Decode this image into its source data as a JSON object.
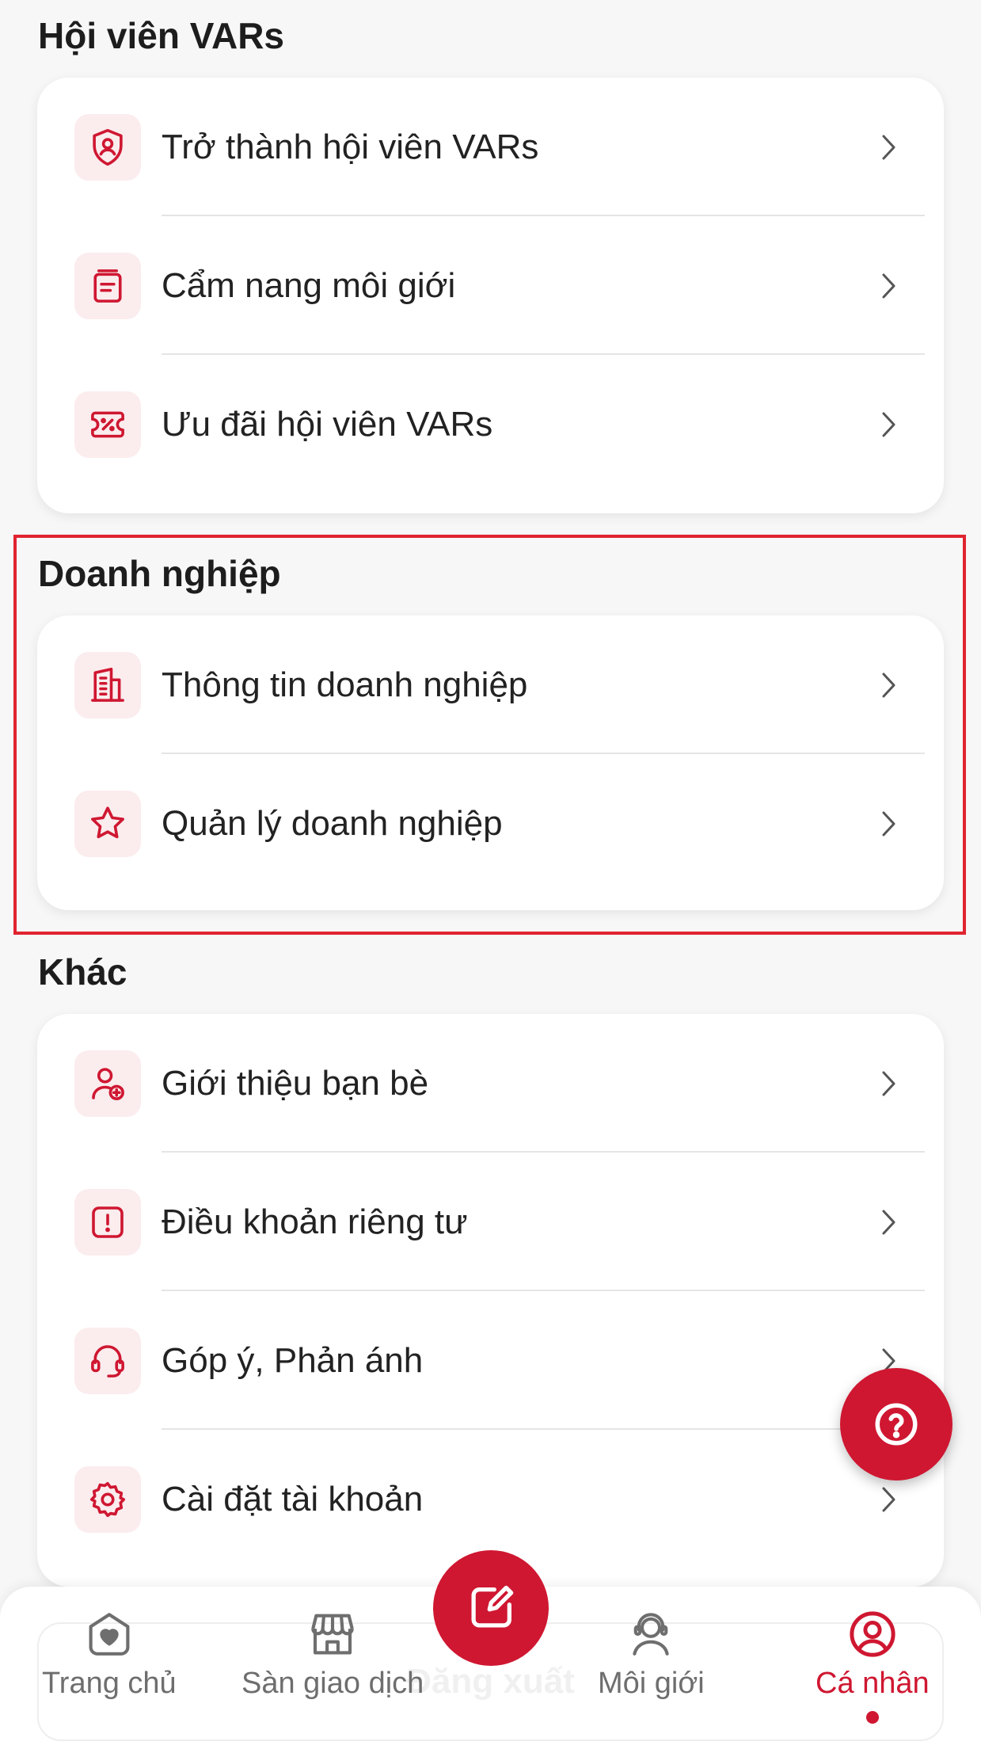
{
  "sections": {
    "members": {
      "title": "Hội viên VARs",
      "items": [
        {
          "label": "Trở thành hội viên VARs",
          "icon": "shield-user-icon"
        },
        {
          "label": "Cẩm nang môi giới",
          "icon": "handbook-icon"
        },
        {
          "label": "Ưu đãi hội viên VARs",
          "icon": "discount-ticket-icon"
        }
      ]
    },
    "business": {
      "title": "Doanh nghiệp",
      "items": [
        {
          "label": "Thông tin doanh nghiệp",
          "icon": "building-icon"
        },
        {
          "label": "Quản lý doanh nghiệp",
          "icon": "star-icon"
        }
      ]
    },
    "other": {
      "title": "Khác",
      "items": [
        {
          "label": "Giới thiệu bạn bè",
          "icon": "user-add-icon"
        },
        {
          "label": "Điều khoản riêng tư",
          "icon": "alert-icon"
        },
        {
          "label": "Góp ý, Phản ánh",
          "icon": "headset-icon"
        },
        {
          "label": "Cài đặt tài khoản",
          "icon": "gear-icon"
        }
      ]
    }
  },
  "logout_label": "Đăng xuất",
  "nav": {
    "home": "Trang chủ",
    "market": "Sàn giao dịch",
    "broker": "Môi giới",
    "profile": "Cá nhân"
  },
  "colors": {
    "accent": "#cf1731",
    "icon_bg": "#fbecee",
    "highlight": "#e0242f"
  }
}
